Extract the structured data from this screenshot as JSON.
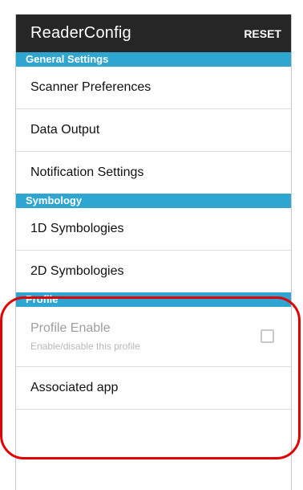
{
  "app": {
    "title": "ReaderConfig",
    "reset_label": "RESET"
  },
  "sections": [
    {
      "header": "General Settings",
      "items": [
        "Scanner Preferences",
        "Data Output",
        "Notification Settings"
      ]
    },
    {
      "header": "Symbology",
      "items": [
        "1D Symbologies",
        "2D Symbologies"
      ]
    },
    {
      "header": "Profile",
      "profile_enable": {
        "label": "Profile Enable",
        "sublabel": "Enable/disable this profile",
        "checked": false
      },
      "items": [
        "Associated app"
      ]
    }
  ],
  "colors": {
    "appbar": "#262626",
    "section_header": "#2ea6d1",
    "highlight": "#e10000"
  }
}
